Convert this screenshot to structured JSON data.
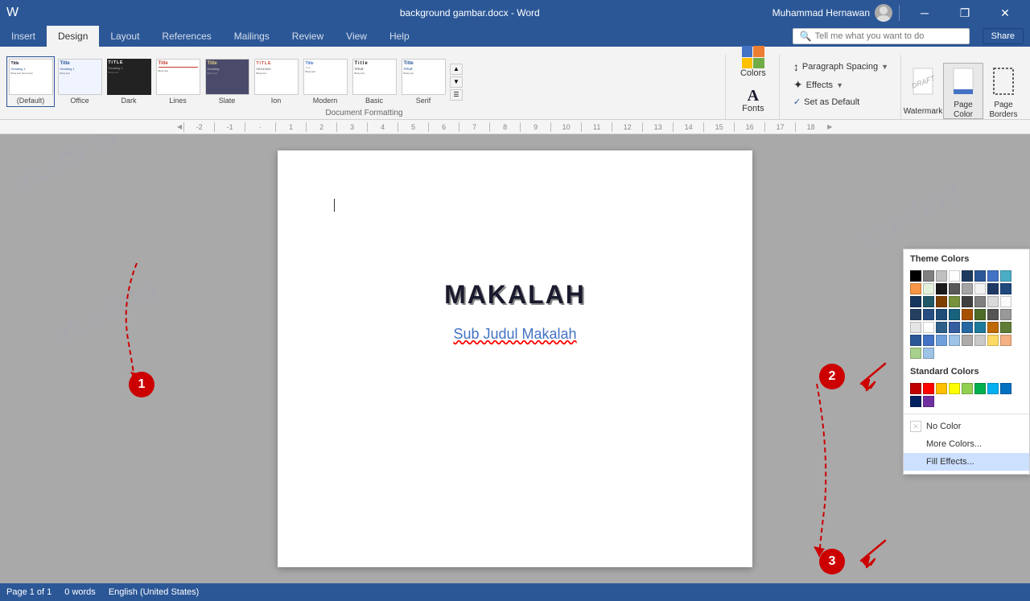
{
  "titlebar": {
    "filename": "background gambar.docx - Word",
    "username": "Muhammad Hernawan",
    "minimize": "─",
    "restore": "❐",
    "close": "✕"
  },
  "tabs": {
    "items": [
      "Insert",
      "Design",
      "Layout",
      "References",
      "Mailings",
      "Review",
      "View",
      "Help"
    ]
  },
  "active_tab": "Design",
  "ribbon": {
    "document_formatting_label": "Document Formatting",
    "themes": [
      {
        "label": "Title",
        "type": "plain"
      },
      {
        "label": "Title",
        "type": "blue"
      },
      {
        "label": "TITLE",
        "type": "dark"
      },
      {
        "label": "Title",
        "type": "lines"
      },
      {
        "label": "Title",
        "type": "slate"
      },
      {
        "label": "TITLE",
        "type": "caps"
      },
      {
        "label": "Title",
        "type": "modern"
      },
      {
        "label": "TITLE",
        "type": "caps2"
      },
      {
        "label": "Title",
        "type": "serif"
      }
    ],
    "colors_label": "Colors",
    "fonts_label": "Fonts",
    "paragraph_spacing_label": "Paragraph Spacing",
    "effects_label": "Effects",
    "set_default_label": "Set as Default",
    "watermark_label": "Watermark",
    "page_color_label": "Page Color",
    "page_borders_label": "Page Borders"
  },
  "dropdown": {
    "theme_colors_title": "Theme Colors",
    "standard_colors_title": "Standard Colors",
    "no_color_label": "No Color",
    "more_colors_label": "More Colors...",
    "fill_effects_label": "Fill Effects...",
    "theme_colors": [
      "#000000",
      "#808080",
      "#c0c0c0",
      "#ffffff",
      "#1e3a5f",
      "#2b5797",
      "#4472c4",
      "#4bacc6",
      "#f79646",
      "#e2efda",
      "#1a1a1a",
      "#595959",
      "#a5a5a5",
      "#f2f2f2",
      "#1f3864",
      "#1f497d",
      "#17375e",
      "#215868",
      "#7f3f00",
      "#76923c",
      "#404040",
      "#7f7f7f",
      "#d9d9d9",
      "#fafafa",
      "#243f60",
      "#274e82",
      "#1e4d78",
      "#17627d",
      "#a75100",
      "#4e6b28",
      "#555",
      "#999",
      "#e5e5e5",
      "#fefefe",
      "#2e5f8a",
      "#365da0",
      "#2567a0",
      "#1d7a9a",
      "#bf6a00",
      "#607d36",
      "#2b5797",
      "#4472c4",
      "#70a0dc",
      "#9dc3e6",
      "#aeaaaa",
      "#c9c9c9",
      "#ffd966",
      "#f4b183",
      "#a9d18e",
      "#9dc3e6"
    ],
    "standard_colors": [
      "#c00000",
      "#ff0000",
      "#ffc000",
      "#ffff00",
      "#92d050",
      "#00b050",
      "#00b0f0",
      "#0070c0",
      "#002060",
      "#7030a0"
    ]
  },
  "document": {
    "title": "MAKALAH",
    "subtitle": "Sub Judul Makalah"
  },
  "statusbar": {
    "page_info": "Page 1 of 1",
    "words": "0 words",
    "lang": "English (United States)"
  },
  "steps": {
    "step1_label": "1",
    "step2_label": "2",
    "step3_label": "3"
  },
  "search_placeholder": "Tell me what you want to do",
  "share_label": "Share"
}
